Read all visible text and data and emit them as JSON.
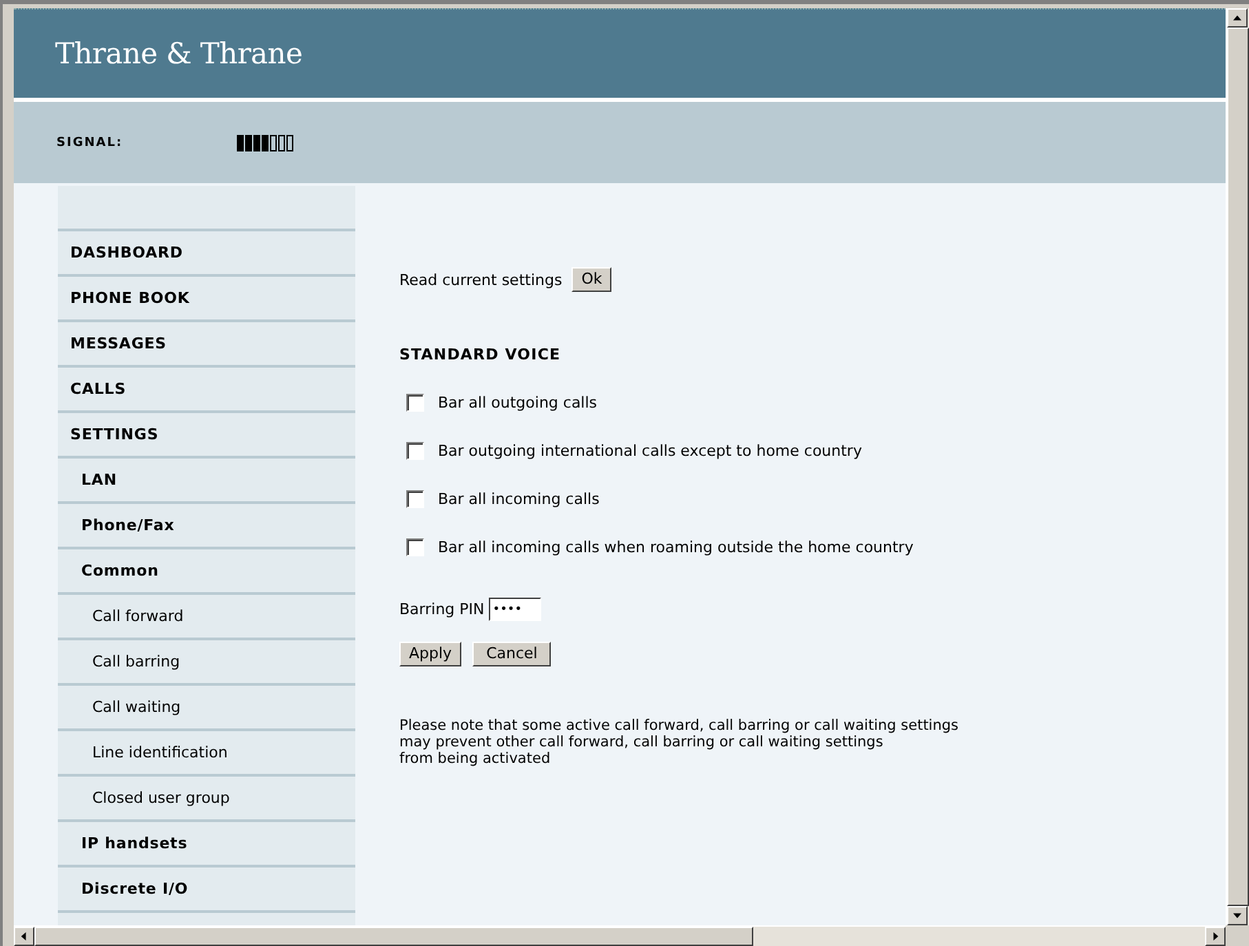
{
  "header": {
    "logo": "Thrane & Thrane",
    "signal_label": "SIGNAL:",
    "signal": {
      "level": 0.571
    }
  },
  "sidebar": {
    "items": [
      {
        "label": "DASHBOARD",
        "selected": false
      },
      {
        "label": "PHONE BOOK",
        "selected": false
      },
      {
        "label": "MESSAGES",
        "selected": false
      },
      {
        "label": "CALLS",
        "selected": false
      },
      {
        "label": "SETTINGS",
        "selected": false,
        "children": [
          {
            "label": "LAN",
            "selected": false
          },
          {
            "label": "Phone/Fax",
            "selected": false
          },
          {
            "label": "Common",
            "selected": false,
            "children": [
              {
                "label": "Call forward",
                "selected": false
              },
              {
                "label": "Call barring",
                "selected": false
              },
              {
                "label": "Call waiting",
                "selected": false
              },
              {
                "label": "Line identification",
                "selected": false
              },
              {
                "label": "Closed user group",
                "selected": false
              }
            ]
          },
          {
            "label": "IP handsets",
            "selected": false
          },
          {
            "label": "Discrete I/O",
            "selected": false
          }
        ]
      }
    ]
  },
  "content": {
    "read_label": "Read current settings",
    "read_button": "Ok",
    "section_title": "STANDARD VOICE",
    "options": [
      {
        "label": "Bar all outgoing calls",
        "checked": false
      },
      {
        "label": "Bar outgoing international calls except to home country",
        "checked": false
      },
      {
        "label": "Bar all incoming calls",
        "checked": false
      },
      {
        "label": "Bar all incoming calls when roaming outside the home country",
        "checked": false
      }
    ],
    "pin": {
      "label": "Barring PIN",
      "value": "••••"
    },
    "buttons": [
      "Apply",
      "Cancel"
    ],
    "note_lines": [
      "Please note that some active call forward, call barring or call waiting settings",
      "may prevent other call forward, call barring or call waiting settings",
      "from being activated"
    ]
  }
}
